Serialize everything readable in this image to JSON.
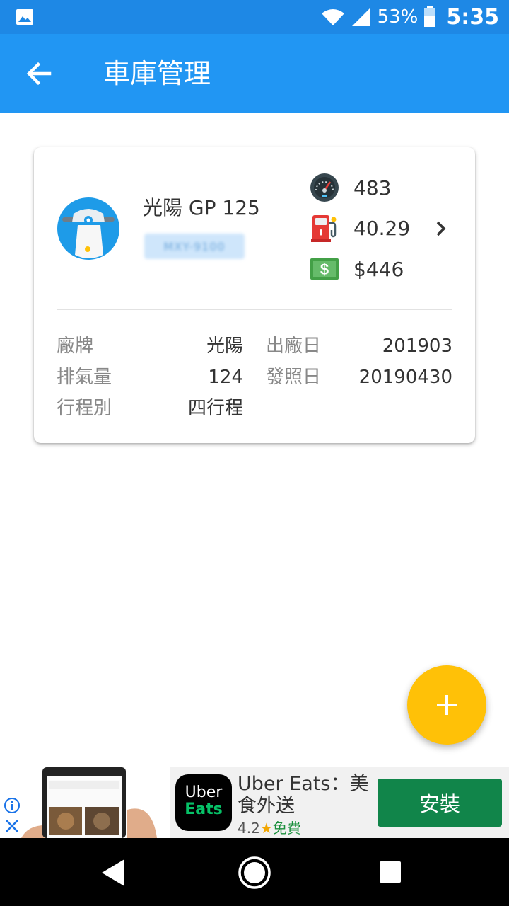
{
  "status_bar": {
    "battery_percent": "53%",
    "time": "5:35",
    "icons": [
      "gallery-icon",
      "wifi-icon",
      "signal-icon",
      "battery-icon"
    ]
  },
  "app_bar": {
    "title": "車庫管理",
    "back_icon": "arrow-back-icon"
  },
  "vehicle": {
    "name": "光陽 GP 125",
    "plate_blurred": "MXY-9100",
    "avatar_icon": "scooter-icon",
    "stats": {
      "odometer": "483",
      "fuel": "40.29",
      "cost": "$446"
    },
    "specs": {
      "brand_label": "廠牌",
      "brand_value": "光陽",
      "displacement_label": "排氣量",
      "displacement_value": "124",
      "stroke_label": "行程別",
      "stroke_value": "四行程",
      "manufacture_label": "出廠日",
      "manufacture_value": "201903",
      "license_label": "發照日",
      "license_value": "20190430"
    }
  },
  "fab": {
    "icon": "plus-icon"
  },
  "ad": {
    "logo_top": "Uber",
    "logo_bottom": "Eats",
    "title": "Uber Eats：美食外送",
    "rating": "4.2",
    "price": "免費",
    "install_label": "安裝"
  },
  "colors": {
    "status_bar": "#1e88e5",
    "app_bar": "#2196f3",
    "fab": "#ffc107",
    "install_button": "#11854a"
  }
}
